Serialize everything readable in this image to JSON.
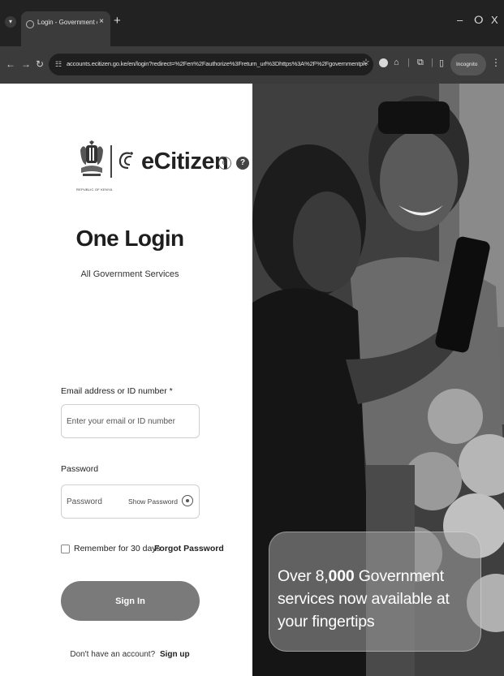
{
  "browser": {
    "tab_title": "Login - Government of Kenya | e",
    "url": "accounts.ecitizen.go.ke/en/login?redirect=%2Fen%2Fauthorize%3Freturn_url%3Dhttps%3A%2F%2Fgovernmentpress.ecitizen.go.k...",
    "incognito_label": "Incognito",
    "new_tab": "+",
    "tab_close": "×",
    "minimize": "–",
    "restore": "ⵔ",
    "close": "X"
  },
  "brand": {
    "coat_caption": "REPUBLIC OF KENYA",
    "name": "eCitizen"
  },
  "header": {
    "title": "One Login",
    "subtitle": "All Government Services"
  },
  "form": {
    "email_label": "Email address or ID number *",
    "email_placeholder": "Enter your email or ID number",
    "password_label": "Password",
    "password_placeholder": "Password",
    "show_password": "Show Password",
    "remember_label": "Remember for 30 days",
    "forgot_password": "Forgot Password",
    "sign_in": "Sign In",
    "no_account": "Don't have an account?",
    "sign_up": "Sign up"
  },
  "hero": {
    "text_prefix": "Over 8,",
    "text_bold": "000",
    "text_suffix": " Government services now available at your fingertips"
  }
}
